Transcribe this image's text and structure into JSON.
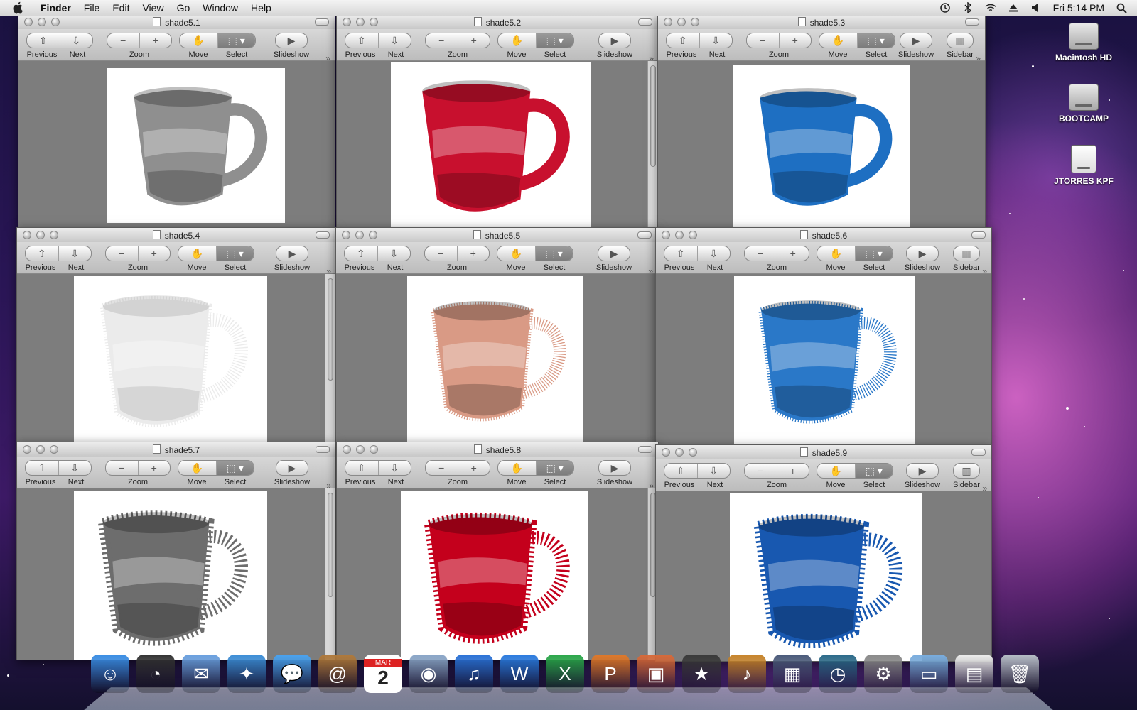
{
  "menubar": {
    "app": "Finder",
    "items": [
      "File",
      "Edit",
      "View",
      "Go",
      "Window",
      "Help"
    ],
    "clock": "Fri 5:14 PM"
  },
  "desktop_icons": [
    {
      "label": "Macintosh HD"
    },
    {
      "label": "BOOTCAMP"
    },
    {
      "label": "JTORRES KPF"
    }
  ],
  "toolbar": {
    "previous": "Previous",
    "next": "Next",
    "zoom": "Zoom",
    "move": "Move",
    "select": "Select",
    "slideshow": "Slideshow",
    "sidebar": "Sidebar",
    "zoom_out": "−",
    "zoom_in": "+"
  },
  "windows": [
    {
      "title": "shade5.1",
      "style": "gray smooth",
      "color": "#8f8f8f",
      "sidebar": false
    },
    {
      "title": "shade5.2",
      "style": "red smooth",
      "color": "#c8102e",
      "sidebar": false
    },
    {
      "title": "shade5.3",
      "style": "blue smooth",
      "color": "#1e6fc2",
      "sidebar": true
    },
    {
      "title": "shade5.4",
      "style": "light gray fuzzy",
      "color": "#d4d4d4",
      "sidebar": false
    },
    {
      "title": "shade5.5",
      "style": "salmon fuzzy",
      "color": "#d99a85",
      "sidebar": false
    },
    {
      "title": "shade5.6",
      "style": "blue fuzzy",
      "color": "#2a78c8",
      "sidebar": true
    },
    {
      "title": "shade5.7",
      "style": "gray spiky",
      "color": "#6d6d6d",
      "sidebar": false
    },
    {
      "title": "shade5.8",
      "style": "red spiky",
      "color": "#c4001c",
      "sidebar": false
    },
    {
      "title": "shade5.9",
      "style": "blue spiky",
      "color": "#1858b0",
      "sidebar": true
    }
  ],
  "dock": {
    "calendar_month": "MAR",
    "calendar_day": "2",
    "items": [
      "finder-icon",
      "dashboard-icon",
      "mail-icon",
      "safari-icon",
      "ichat-icon",
      "address-book-icon",
      "ical-icon",
      "iphoto-booth-icon",
      "itunes-icon",
      "word-icon",
      "excel-icon",
      "powerpoint-icon",
      "iphoto-icon",
      "imovie-icon",
      "garageband-icon",
      "spaces-icon",
      "time-machine-icon",
      "system-preferences-icon",
      "documents-folder-icon",
      "pdf-stack-icon",
      "trash-icon"
    ]
  }
}
